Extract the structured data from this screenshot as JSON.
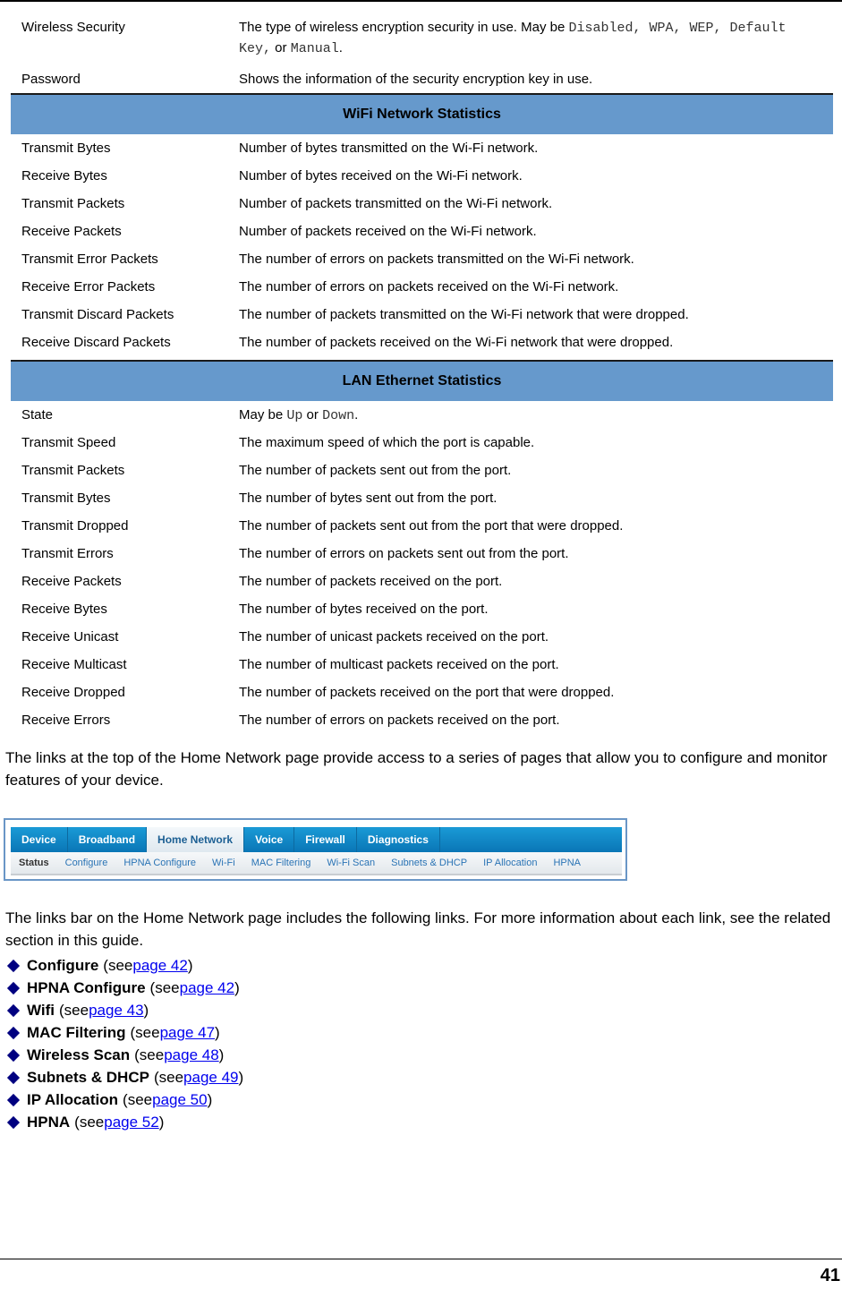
{
  "top_rows": [
    {
      "term": "Wireless Security",
      "desc_parts": [
        {
          "t": "The type of wireless encryption security in use. May be ",
          "mono": false
        },
        {
          "t": "Disabled, WPA, WEP, Default Key,",
          "mono": true
        },
        {
          "t": " or ",
          "mono": false
        },
        {
          "t": "Manual",
          "mono": true
        },
        {
          "t": ".",
          "mono": false
        }
      ]
    },
    {
      "term": "Password",
      "desc": "Shows the information of the security encryption key in use."
    }
  ],
  "wifi_section": {
    "title": "WiFi Network Statistics",
    "rows": [
      {
        "term": "Transmit Bytes",
        "desc": "Number of bytes transmitted on the Wi-Fi network."
      },
      {
        "term": "Receive Bytes",
        "desc": "Number of bytes received on the Wi-Fi network."
      },
      {
        "term": "Transmit Packets",
        "desc": "Number of packets transmitted on the Wi-Fi network."
      },
      {
        "term": "Receive Packets",
        "desc": "Number of packets received on the Wi-Fi network."
      },
      {
        "term": "Transmit Error Packets",
        "desc": "The number of errors on packets transmitted on the Wi-Fi network."
      },
      {
        "term": "Receive Error Packets",
        "desc": "The number of errors on packets received on the Wi-Fi network."
      },
      {
        "term": "Transmit Discard Packets",
        "desc": "The number of packets transmitted on the Wi-Fi network that were dropped."
      },
      {
        "term": "Receive Discard Packets",
        "desc": "The number of packets received on the Wi-Fi network that were dropped."
      }
    ]
  },
  "lan_section": {
    "title": "LAN Ethernet Statistics",
    "state_row": {
      "term": "State",
      "pre": "May be ",
      "up": "Up",
      "or": " or ",
      "down": "Down",
      "end": "."
    },
    "rows": [
      {
        "term": "Transmit Speed",
        "desc": "The maximum speed of which the port is capable."
      },
      {
        "term": "Transmit Packets",
        "desc": "The number of packets sent out from the port."
      },
      {
        "term": "Transmit Bytes",
        "desc": "The number of bytes sent out from the port."
      },
      {
        "term": "Transmit Dropped",
        "desc": "The number of packets sent out from the port that were dropped."
      },
      {
        "term": "Transmit Errors",
        "desc": "The number of errors on packets sent out from the port."
      },
      {
        "term": "Receive Packets",
        "desc": "The number of packets received on the port."
      },
      {
        "term": "Receive Bytes",
        "desc": "The number of bytes received on the port."
      },
      {
        "term": "Receive Unicast",
        "desc": "The number of unicast packets received on the port."
      },
      {
        "term": "Receive Multicast",
        "desc": "The number of multicast packets received on the port."
      },
      {
        "term": "Receive Dropped",
        "desc": "The number of packets received on the port that were dropped."
      },
      {
        "term": "Receive Errors",
        "desc": "The number of errors on packets received on the port."
      }
    ]
  },
  "para1": "The links at the top of the Home Network page provide access to a series of pages that allow you to configure and monitor features of your device.",
  "nav_screenshot": {
    "tabs": [
      "Device",
      "Broadband",
      "Home Network",
      "Voice",
      "Firewall",
      "Diagnostics"
    ],
    "active_tab": "Home Network",
    "subtabs": [
      "Status",
      "Configure",
      "HPNA Configure",
      "Wi-Fi",
      "MAC Filtering",
      "Wi-Fi Scan",
      "Subnets & DHCP",
      "IP Allocation",
      "HPNA"
    ],
    "active_subtab": "Status"
  },
  "para2": "The links bar on the Home Network page includes the following links. For more information about each link, see the related section in this guide.",
  "links": [
    {
      "name": "Configure",
      "page": "page 42"
    },
    {
      "name": "HPNA Configure",
      "page": "page 42"
    },
    {
      "name": "Wifi",
      "page": "page 43"
    },
    {
      "name": "MAC Filtering",
      "page": "page 47"
    },
    {
      "name": "Wireless Scan",
      "page": "page 48"
    },
    {
      "name": "Subnets & DHCP",
      "page": "page 49"
    },
    {
      "name": "IP Allocation",
      "page": "page 50"
    },
    {
      "name": "HPNA",
      "page": "page 52"
    }
  ],
  "see_open": "(see ",
  "see_close": ")",
  "page_number": "41"
}
